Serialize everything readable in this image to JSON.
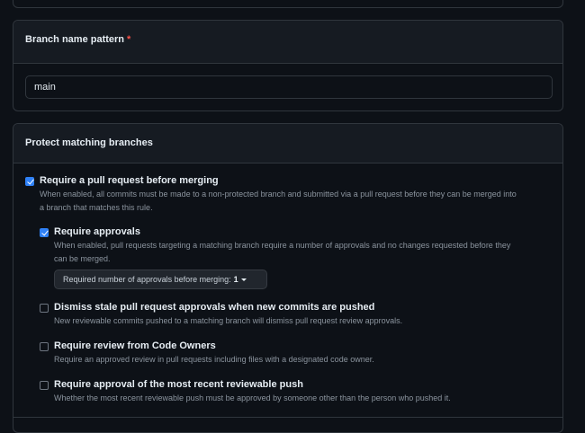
{
  "branch_section": {
    "title": "Branch name pattern",
    "required_mark": "*",
    "pattern_value": "main"
  },
  "protect_section": {
    "title": "Protect matching branches",
    "options": [
      {
        "label": "Require a pull request before merging",
        "checked": true,
        "description_line1": "When enabled, all commits must be made to a non-protected branch and submitted via a pull request before they can be merged into",
        "description_line2": "a branch that matches this rule."
      },
      {
        "label": "Require approvals",
        "checked": true,
        "description_line1": "When enabled, pull requests targeting a matching branch require a number of approvals and no changes requested before they",
        "description_line2": "can be merged."
      },
      {
        "label": "Dismiss stale pull request approvals when new commits are pushed",
        "checked": false,
        "description_line1": "New reviewable commits pushed to a matching branch will dismiss pull request review approvals."
      },
      {
        "label": "Require review from Code Owners",
        "checked": false,
        "description_line1": "Require an approved review in pull requests including files with a designated code owner."
      },
      {
        "label": "Require approval of the most recent reviewable push",
        "checked": false,
        "description_line1": "Whether the most recent reviewable push must be approved by someone other than the person who pushed it."
      }
    ],
    "approvals_select": {
      "label": "Required number of approvals before merging:",
      "value": "1"
    }
  },
  "colors": {
    "background": "#0d1117",
    "panel_header": "#161b22",
    "border": "#30363d",
    "accent": "#2f81f7",
    "required": "#f85149",
    "muted_text": "#8b949e"
  }
}
